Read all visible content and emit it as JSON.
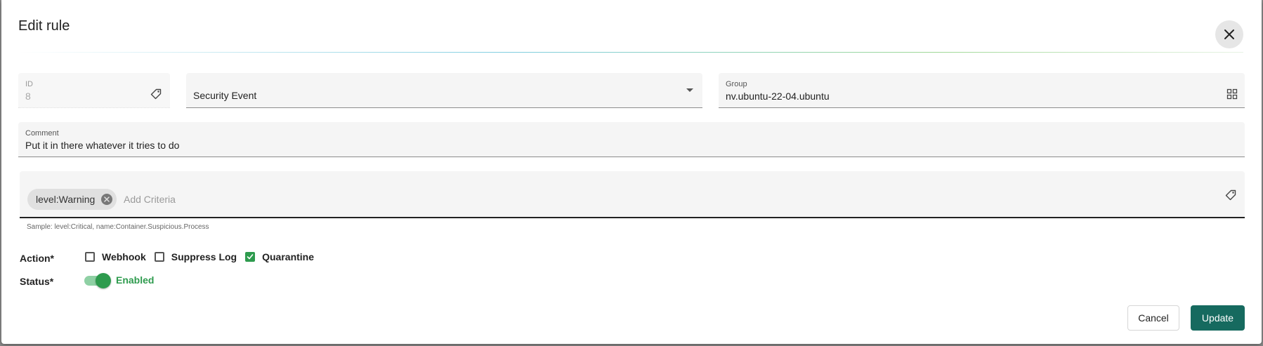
{
  "dialog": {
    "title": "Edit rule",
    "close_icon": "close-icon"
  },
  "form": {
    "id_field": {
      "label": "ID",
      "value": "8",
      "icon": "tag-icon"
    },
    "type_select": {
      "value": "Security Event",
      "icon": "dropdown-arrow-icon"
    },
    "group_field": {
      "label": "Group",
      "value": "nv.ubuntu-22-04.ubuntu",
      "icon": "grid-icon"
    },
    "comment_field": {
      "label": "Comment",
      "value": "Put it in there whatever it tries to do"
    },
    "criteria": {
      "chips": [
        {
          "label": "level:Warning"
        }
      ],
      "placeholder": "Add Criteria",
      "icon": "tag-icon",
      "hint": "Sample: level:Critical, name:Container.Suspicious.Process"
    },
    "action": {
      "label": "Action*",
      "options": [
        {
          "label": "Webhook",
          "checked": false
        },
        {
          "label": "Suppress Log",
          "checked": false
        },
        {
          "label": "Quarantine",
          "checked": true
        }
      ]
    },
    "status": {
      "label": "Status*",
      "enabled": true,
      "state_label": "Enabled"
    }
  },
  "footer": {
    "cancel_label": "Cancel",
    "update_label": "Update"
  },
  "colors": {
    "accent_green": "#2e9b4e",
    "primary_button": "#166a5f"
  }
}
